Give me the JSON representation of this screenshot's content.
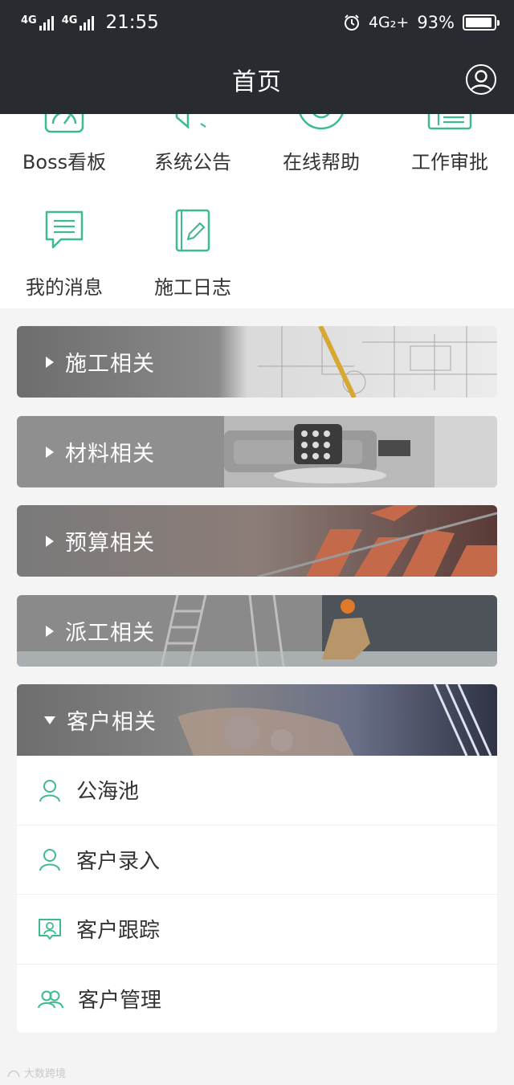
{
  "status_bar": {
    "signal1": "4G",
    "signal2": "4G",
    "time": "21:55",
    "network": "4G₂+",
    "battery": "93%",
    "battery_level": 0.93
  },
  "nav": {
    "title": "首页"
  },
  "quick_items": [
    {
      "label": "Boss看板",
      "icon": "dashboard-icon"
    },
    {
      "label": "系统公告",
      "icon": "megaphone-icon"
    },
    {
      "label": "在线帮助",
      "icon": "support-icon"
    },
    {
      "label": "工作审批",
      "icon": "approval-icon"
    },
    {
      "label": "我的消息",
      "icon": "message-icon"
    },
    {
      "label": "施工日志",
      "icon": "log-book-icon"
    }
  ],
  "panels": [
    {
      "label": "施工相关",
      "expanded": false
    },
    {
      "label": "材料相关",
      "expanded": false
    },
    {
      "label": "预算相关",
      "expanded": false
    },
    {
      "label": "派工相关",
      "expanded": false
    },
    {
      "label": "客户相关",
      "expanded": true
    }
  ],
  "customer_items": [
    {
      "label": "公海池",
      "icon": "user-icon"
    },
    {
      "label": "客户录入",
      "icon": "user-add-icon"
    },
    {
      "label": "客户跟踪",
      "icon": "contact-card-icon"
    },
    {
      "label": "客户管理",
      "icon": "group-icon"
    }
  ],
  "watermark": "大数跨境",
  "colors": {
    "header_bg": "#282b30",
    "accent": "#3dbb8c",
    "page_bg": "#f4f4f4"
  }
}
